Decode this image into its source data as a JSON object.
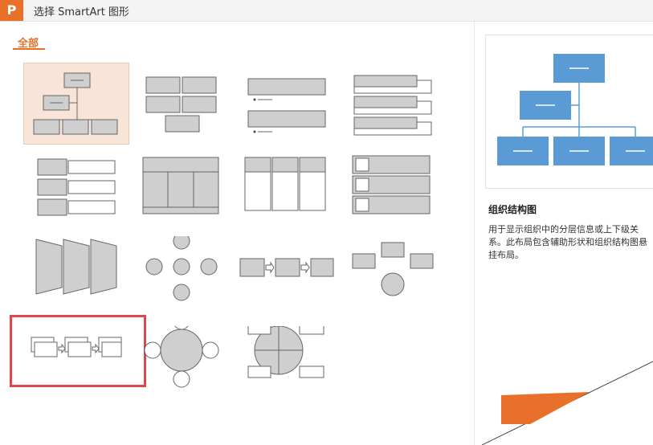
{
  "dialog": {
    "title": "选择 SmartArt 图形",
    "app_icon": "P"
  },
  "category": {
    "active": "全部"
  },
  "layouts": [
    {
      "id": "org-chart",
      "selected": true
    },
    {
      "id": "block-list"
    },
    {
      "id": "bullet-list"
    },
    {
      "id": "stacked-list"
    },
    {
      "id": "bulleted-vertical"
    },
    {
      "id": "table-hierarchy"
    },
    {
      "id": "column-list"
    },
    {
      "id": "picture-list"
    },
    {
      "id": "trapezoid-list"
    },
    {
      "id": "radial-cycle"
    },
    {
      "id": "basic-process"
    },
    {
      "id": "converging"
    },
    {
      "id": "step-process",
      "highlighted": true
    },
    {
      "id": "radial-circle"
    },
    {
      "id": "quad-cycle"
    }
  ],
  "preview": {
    "name": "组织结构图",
    "description": "用于显示组织中的分层信息或上下级关系。此布局包含辅助形状和组织结构图悬挂布局。"
  },
  "colors": {
    "accent": "#e8702a",
    "highlight": "#e0474a",
    "preview_box": "#4a90d9"
  }
}
